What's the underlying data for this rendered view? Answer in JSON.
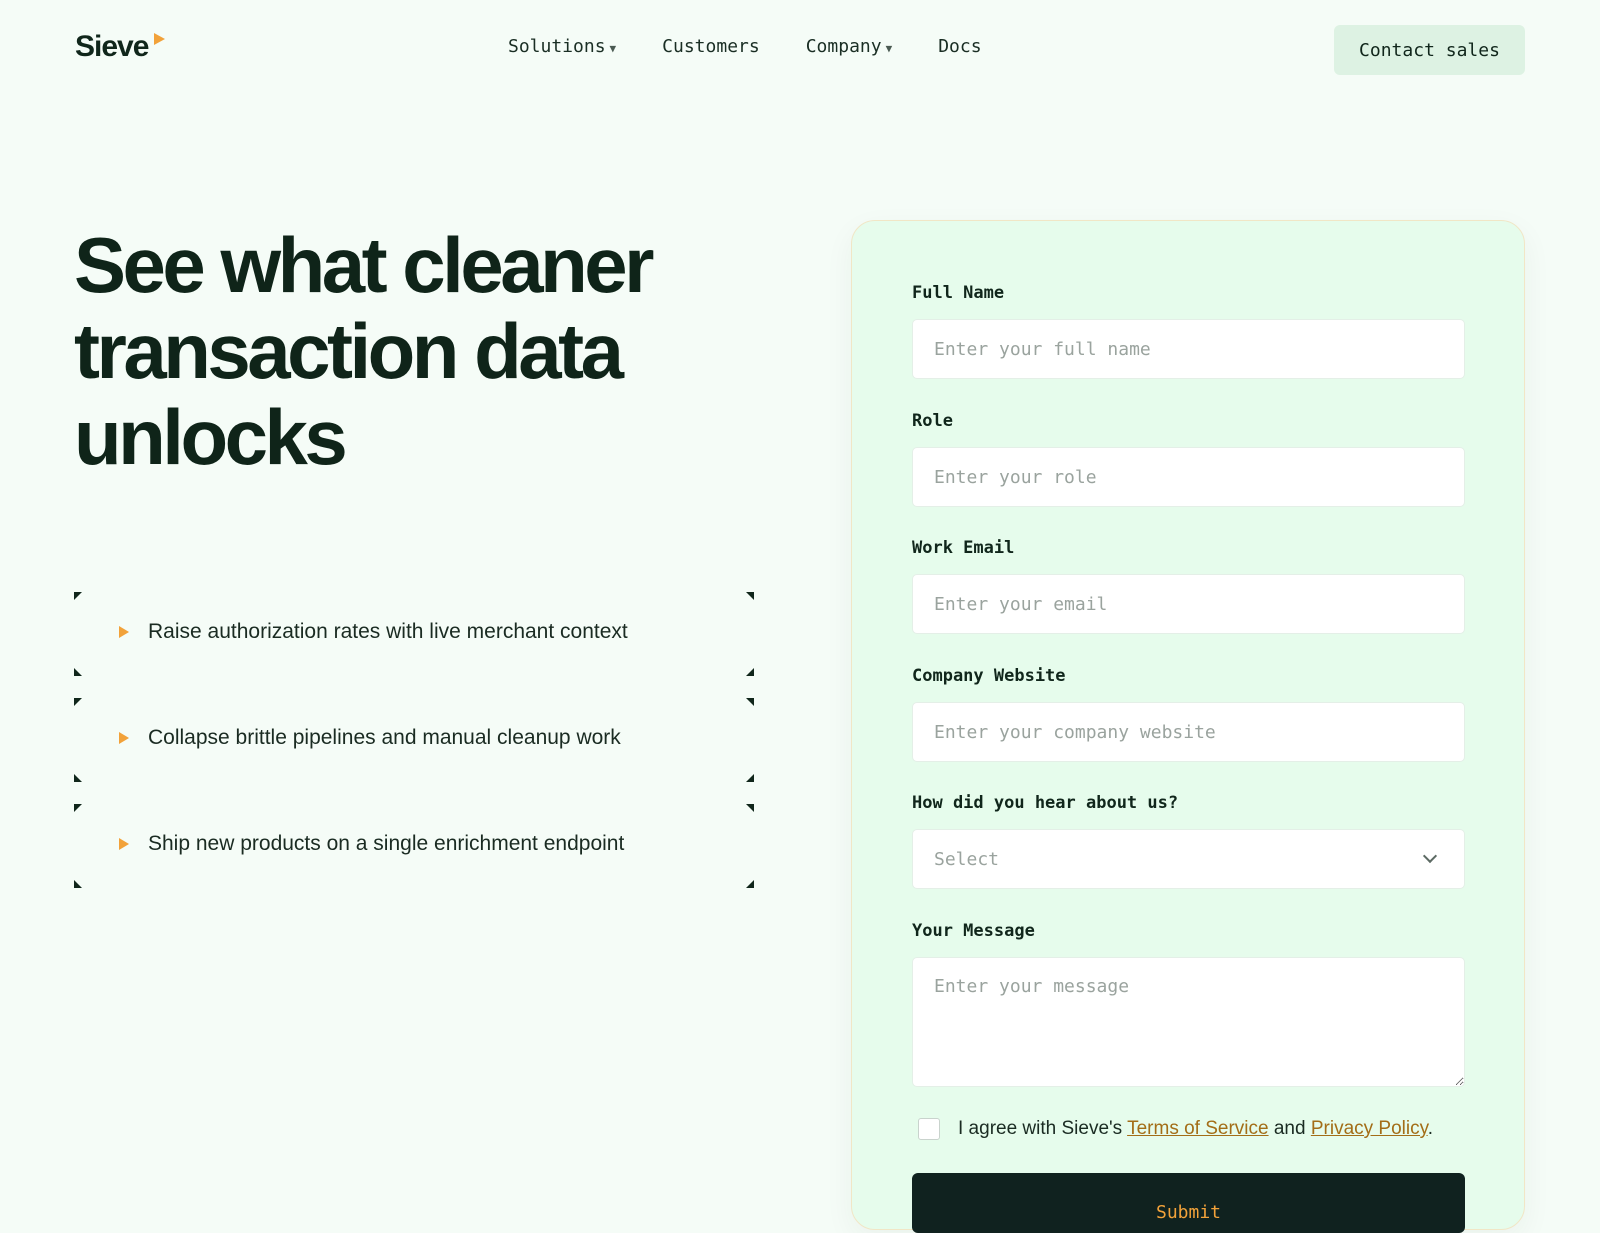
{
  "brand": {
    "name": "Sieve",
    "accent": "#f2a23a"
  },
  "nav": {
    "links": [
      {
        "label": "Solutions",
        "has_caret": true
      },
      {
        "label": "Customers",
        "has_caret": false
      },
      {
        "label": "Company",
        "has_caret": true
      },
      {
        "label": "Docs",
        "has_caret": false
      }
    ],
    "cta": "Contact sales"
  },
  "hero": {
    "title": "See what cleaner transaction data unlocks",
    "features": [
      "Raise authorization rates with live merchant context",
      "Collapse brittle pipelines and manual cleanup work",
      "Ship new products on a single enrichment endpoint"
    ]
  },
  "form": {
    "full_name": {
      "label": "Full Name",
      "placeholder": "Enter your full name"
    },
    "role": {
      "label": "Role",
      "placeholder": "Enter your role"
    },
    "email": {
      "label": "Work Email",
      "placeholder": "Enter your email"
    },
    "website": {
      "label": "Company Website",
      "placeholder": "Enter your company website"
    },
    "referral": {
      "label": "How did you hear about us?",
      "selected": "Select"
    },
    "message": {
      "label": "Your Message",
      "placeholder": "Enter your message"
    },
    "agree": {
      "prefix": "I agree with Sieve's ",
      "terms": "Terms of Service",
      "middle": " and ",
      "privacy": "Privacy Policy",
      "suffix": "."
    },
    "submit": "Submit"
  }
}
